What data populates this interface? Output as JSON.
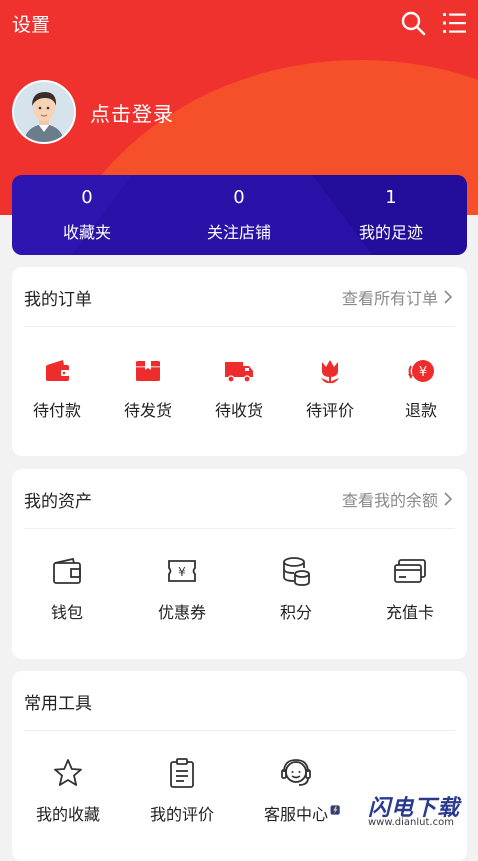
{
  "header": {
    "settings_label": "设置",
    "login_label": "点击登录"
  },
  "stats": [
    {
      "value": "0",
      "label": "收藏夹"
    },
    {
      "value": "0",
      "label": "关注店铺"
    },
    {
      "value": "1",
      "label": "我的足迹"
    }
  ],
  "orders": {
    "title": "我的订单",
    "more": "查看所有订单",
    "items": [
      {
        "label": "待付款",
        "icon": "wallet-icon"
      },
      {
        "label": "待发货",
        "icon": "box-icon"
      },
      {
        "label": "待收货",
        "icon": "truck-icon"
      },
      {
        "label": "待评价",
        "icon": "flower-icon"
      },
      {
        "label": "退款",
        "icon": "refund-icon"
      }
    ]
  },
  "assets": {
    "title": "我的资产",
    "more": "查看我的余额",
    "items": [
      {
        "label": "钱包",
        "icon": "wallet-outline-icon"
      },
      {
        "label": "优惠券",
        "icon": "coupon-icon"
      },
      {
        "label": "积分",
        "icon": "coins-icon"
      },
      {
        "label": "充值卡",
        "icon": "card-icon"
      }
    ]
  },
  "tools": {
    "title": "常用工具",
    "items": [
      {
        "label": "我的收藏",
        "icon": "star-icon"
      },
      {
        "label": "我的评价",
        "icon": "clipboard-icon"
      },
      {
        "label": "客服中心",
        "icon": "customer-service-icon"
      }
    ]
  },
  "watermark": {
    "name": "闪电下载",
    "url": "www.dianlut.com"
  },
  "colors": {
    "primary_red": "#f0322f",
    "stats_bg": "#2a12a8",
    "icon_red": "#ee2c2c"
  }
}
